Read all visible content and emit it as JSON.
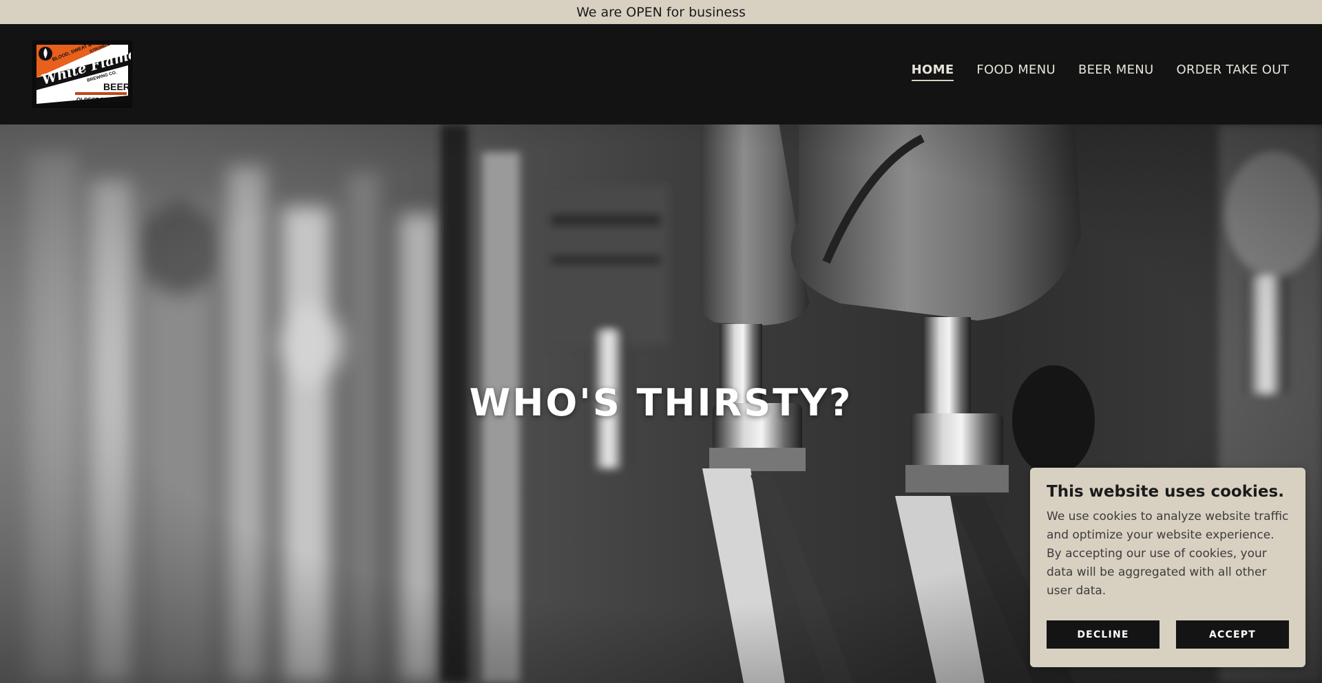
{
  "announcement": {
    "text": "We are OPEN for business"
  },
  "logo": {
    "alt": "White Flame Brewing Co. logo",
    "lines": [
      "BLOOD, SWEAT & BEERS",
      "STRONG BEER",
      "White Flame",
      "BREWING CO.",
      "BEER",
      "OLDEST BREWERY"
    ],
    "colors": {
      "orange": "#e8601c",
      "black": "#111111",
      "white": "#ffffff"
    }
  },
  "nav": {
    "items": [
      {
        "label": "HOME",
        "active": true
      },
      {
        "label": "FOOD MENU",
        "active": false
      },
      {
        "label": "BEER MENU",
        "active": false
      },
      {
        "label": "ORDER TAKE OUT",
        "active": false
      }
    ]
  },
  "hero": {
    "title": "WHO'S THIRSTY?"
  },
  "cookie_banner": {
    "title": "This website uses cookies.",
    "body": "We use cookies to analyze website traffic and optimize your website experience. By accepting our use of cookies, your data will be aggregated with all other user data.",
    "decline_label": "DECLINE",
    "accept_label": "ACCEPT"
  },
  "colors": {
    "announcement_bg": "#d8d1c2",
    "header_bg": "#131313",
    "cookie_bg": "#d8d1c2",
    "button_bg": "#141414"
  }
}
